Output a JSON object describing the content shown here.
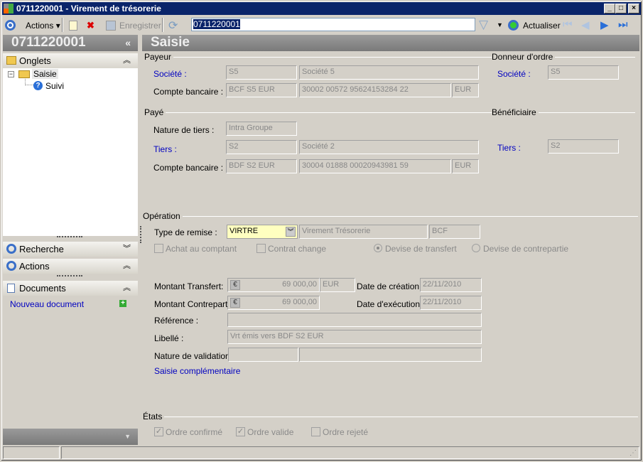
{
  "window": {
    "title": "0711220001 - Virement de trésorerie",
    "controls": [
      "_",
      "□",
      "×"
    ]
  },
  "toolbar": {
    "actions": "Actions",
    "save": "Enregistrer",
    "search_value": "0711220001",
    "refresh": "Actualiser"
  },
  "left": {
    "title": "0711220001",
    "collapse": "«",
    "onglets": "Onglets",
    "tree": [
      "Saisie",
      "Suivi"
    ],
    "recherche": "Recherche",
    "actions": "Actions",
    "documents": "Documents",
    "new_doc": "Nouveau document"
  },
  "main": {
    "title": "Saisie",
    "payeur": {
      "legend": "Payeur",
      "societe_label": "Société :",
      "societe_code": "S5",
      "societe_name": "Société 5",
      "compte_label": "Compte bancaire :",
      "compte_code": "BCF S5 EUR",
      "compte_num": "30002 00572 95624153284 22",
      "compte_cur": "EUR"
    },
    "donneur": {
      "legend": "Donneur d'ordre",
      "societe_label": "Société :",
      "societe_code": "S5"
    },
    "paye": {
      "legend": "Payé",
      "nature_label": "Nature de tiers :",
      "nature": "Intra Groupe",
      "tiers_label": "Tiers :",
      "tiers_code": "S2",
      "tiers_name": "Société 2",
      "compte_label": "Compte bancaire :",
      "compte_code": "BDF S2 EUR",
      "compte_num": "30004 01888 00020943981 59",
      "compte_cur": "EUR"
    },
    "beneficiaire": {
      "legend": "Bénéficiaire",
      "tiers_label": "Tiers :",
      "tiers_code": "S2"
    },
    "operation": {
      "legend": "Opération",
      "type_label": "Type de remise :",
      "type_code": "VIRTRE",
      "type_name": "Virement Trésorerie",
      "type_bank": "BCF",
      "achat": "Achat au comptant",
      "contrat": "Contrat change",
      "devise_transfert": "Devise de transfert",
      "devise_contre": "Devise de contrepartie",
      "mt_label": "Montant Transfert:",
      "mt_value": "69 000,00",
      "mt_cur": "EUR",
      "mc_label": "Montant Contrepartie:",
      "mc_value": "69 000,00",
      "dc_label": "Date de création :",
      "dc_value": "22/11/2010",
      "de_label": "Date d'exécution :",
      "de_value": "22/11/2010",
      "ref_label": "Référence :",
      "ref_value": "",
      "lib_label": "Libellé :",
      "lib_value": "Vrt émis vers BDF S2 EUR",
      "nv_label": "Nature de validation :",
      "saisie_comp": "Saisie complémentaire"
    },
    "etats": {
      "legend": "États",
      "confirme": "Ordre confirmé",
      "valide": "Ordre valide",
      "rejete": "Ordre rejeté"
    }
  }
}
